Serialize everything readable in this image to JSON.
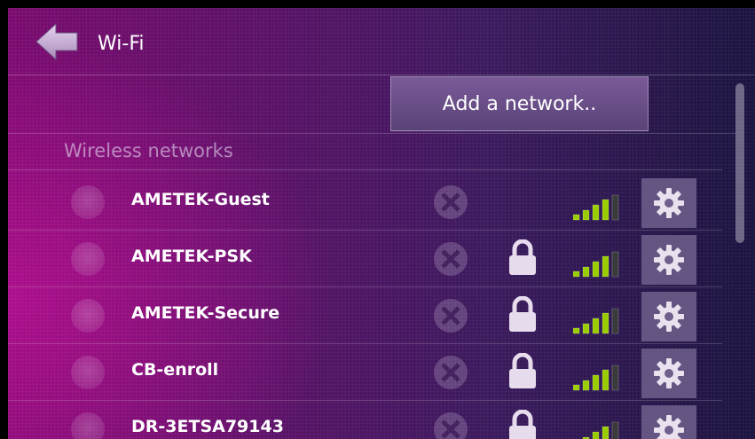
{
  "header": {
    "title": "Wi-Fi",
    "back_icon": "arrow-left-icon"
  },
  "actions": {
    "add_network_label": "Add a network.."
  },
  "section": {
    "label": "Wireless networks"
  },
  "networks": [
    {
      "ssid": "AMETEK-Guest",
      "secured": false,
      "signal_bars": 4
    },
    {
      "ssid": "AMETEK-PSK",
      "secured": true,
      "signal_bars": 4
    },
    {
      "ssid": "AMETEK-Secure",
      "secured": true,
      "signal_bars": 4
    },
    {
      "ssid": "CB-enroll",
      "secured": true,
      "signal_bars": 4
    },
    {
      "ssid": "DR-3ETSA79143",
      "secured": true,
      "signal_bars": 4
    }
  ],
  "colors": {
    "signal_on": "#9acd00",
    "signal_off": "#3a3a3a",
    "accent": "#c20f9a"
  }
}
